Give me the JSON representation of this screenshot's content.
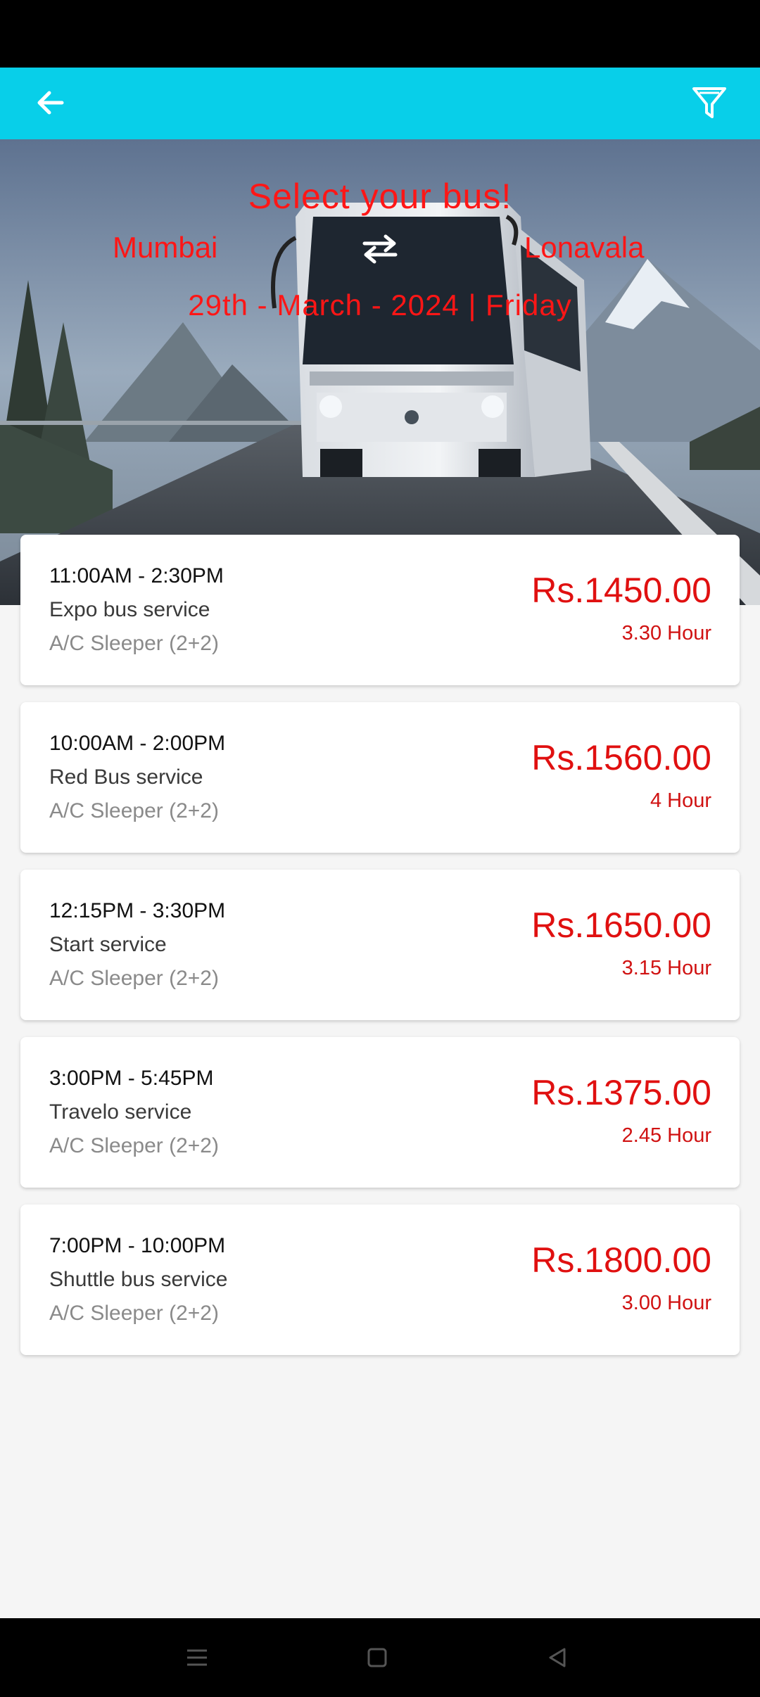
{
  "icons": {
    "back": "arrow-left-icon",
    "filter": "filter-icon",
    "swap": "swap-arrows-icon",
    "nav_menu": "menu-icon",
    "nav_home": "home-square-icon",
    "nav_back": "back-triangle-icon"
  },
  "colors": {
    "app_bar": "#08cfe9",
    "accent_red": "#e01010"
  },
  "hero": {
    "title": "Select your bus!",
    "from": "Mumbai",
    "to": "Lonavala",
    "date": "29th - March - 2024 | Friday"
  },
  "buses": [
    {
      "time": "11:00AM - 2:30PM",
      "name": "Expo bus service",
      "type": "A/C Sleeper (2+2)",
      "price": "Rs.1450.00",
      "duration": "3.30 Hour"
    },
    {
      "time": "10:00AM - 2:00PM",
      "name": "Red Bus service",
      "type": "A/C Sleeper (2+2)",
      "price": "Rs.1560.00",
      "duration": "4 Hour"
    },
    {
      "time": "12:15PM - 3:30PM",
      "name": "Start service",
      "type": "A/C Sleeper (2+2)",
      "price": "Rs.1650.00",
      "duration": "3.15 Hour"
    },
    {
      "time": "3:00PM - 5:45PM",
      "name": "Travelo service",
      "type": "A/C Sleeper (2+2)",
      "price": "Rs.1375.00",
      "duration": "2.45 Hour"
    },
    {
      "time": "7:00PM - 10:00PM",
      "name": "Shuttle bus service",
      "type": "A/C Sleeper (2+2)",
      "price": "Rs.1800.00",
      "duration": "3.00 Hour"
    }
  ]
}
